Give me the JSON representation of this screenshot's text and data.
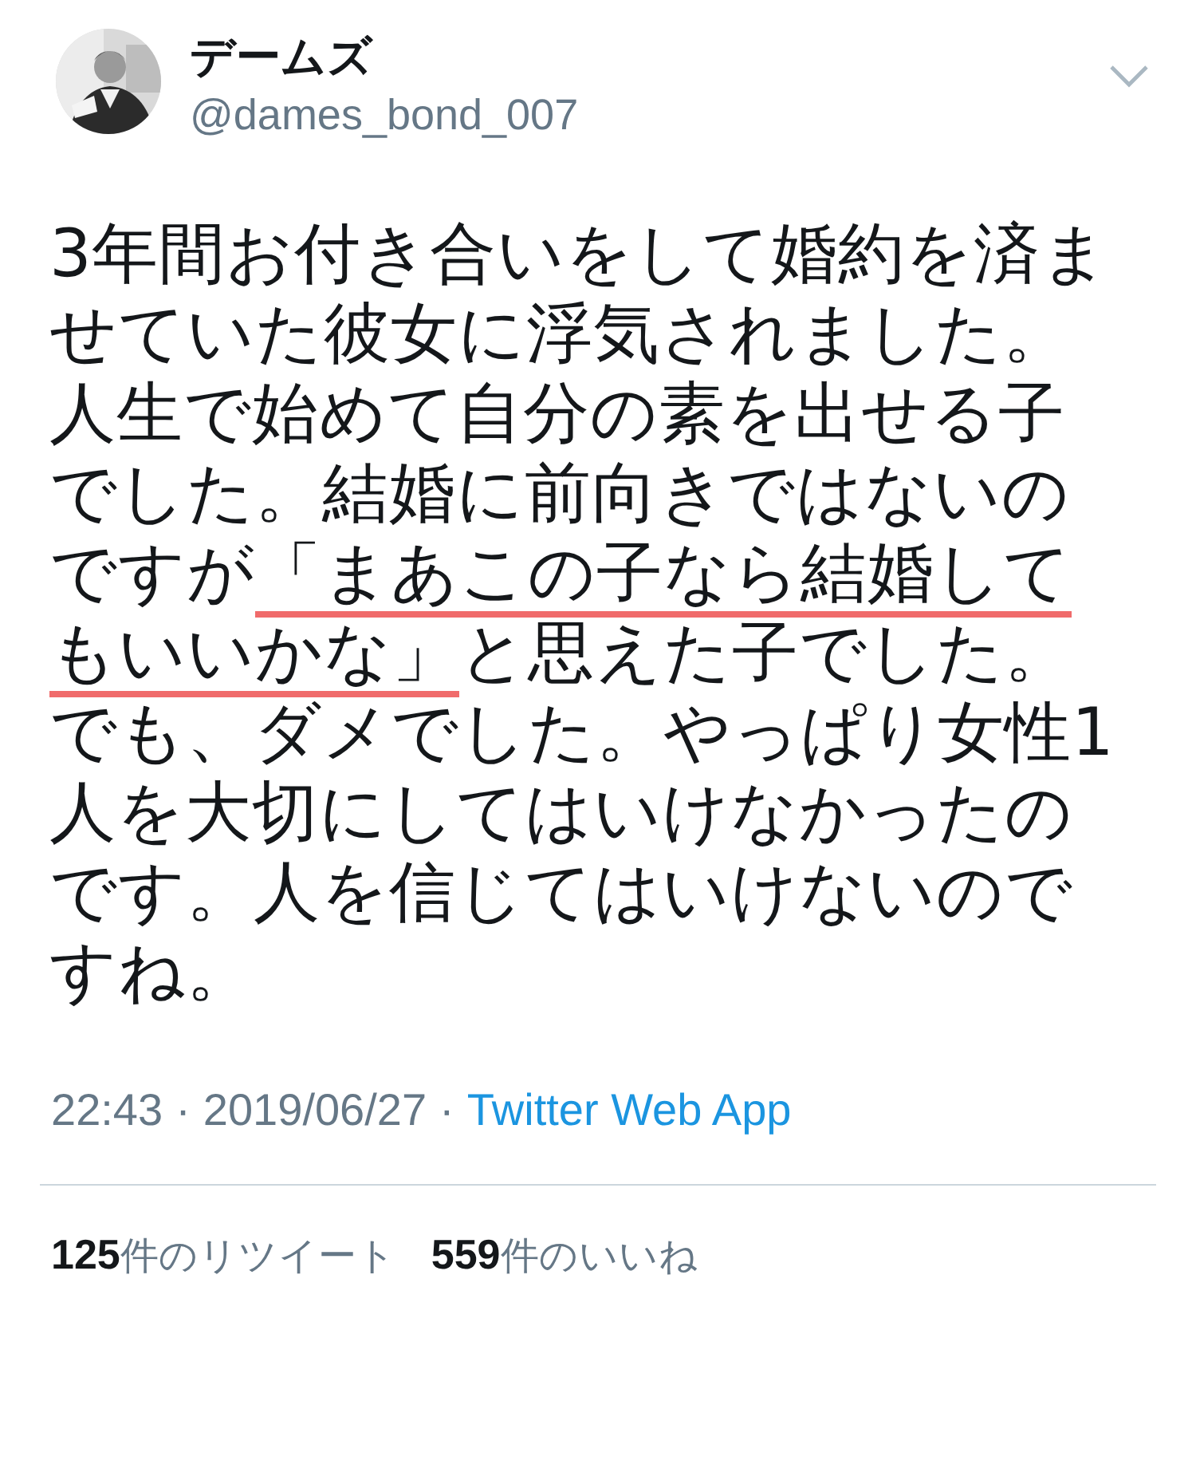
{
  "author": {
    "name": "デームズ",
    "handle": "@dames_bond_007"
  },
  "body": [
    {
      "text": "3年間お付き合いをして婚約を済ませていた彼女に浮気されました。人生で始めて自分の素を出せる子でした。結婚に前向きではないのですが",
      "underlined": false
    },
    {
      "text": "「まあこの子なら結婚してもいいかな」",
      "underlined": true
    },
    {
      "text": "と思えた子でした。でも、ダメでした。やっぱり女性1人を大切にしてはいけなかったのです。人を信じてはいけないのですね。",
      "underlined": false
    }
  ],
  "meta": {
    "time": "22:43",
    "separator_1": "·",
    "date": "2019/06/27",
    "separator_2": "·",
    "source": "Twitter Web App"
  },
  "stats": [
    {
      "count": "125",
      "label": "件のリツイート"
    },
    {
      "count": "559",
      "label": "件のいいね"
    }
  ]
}
